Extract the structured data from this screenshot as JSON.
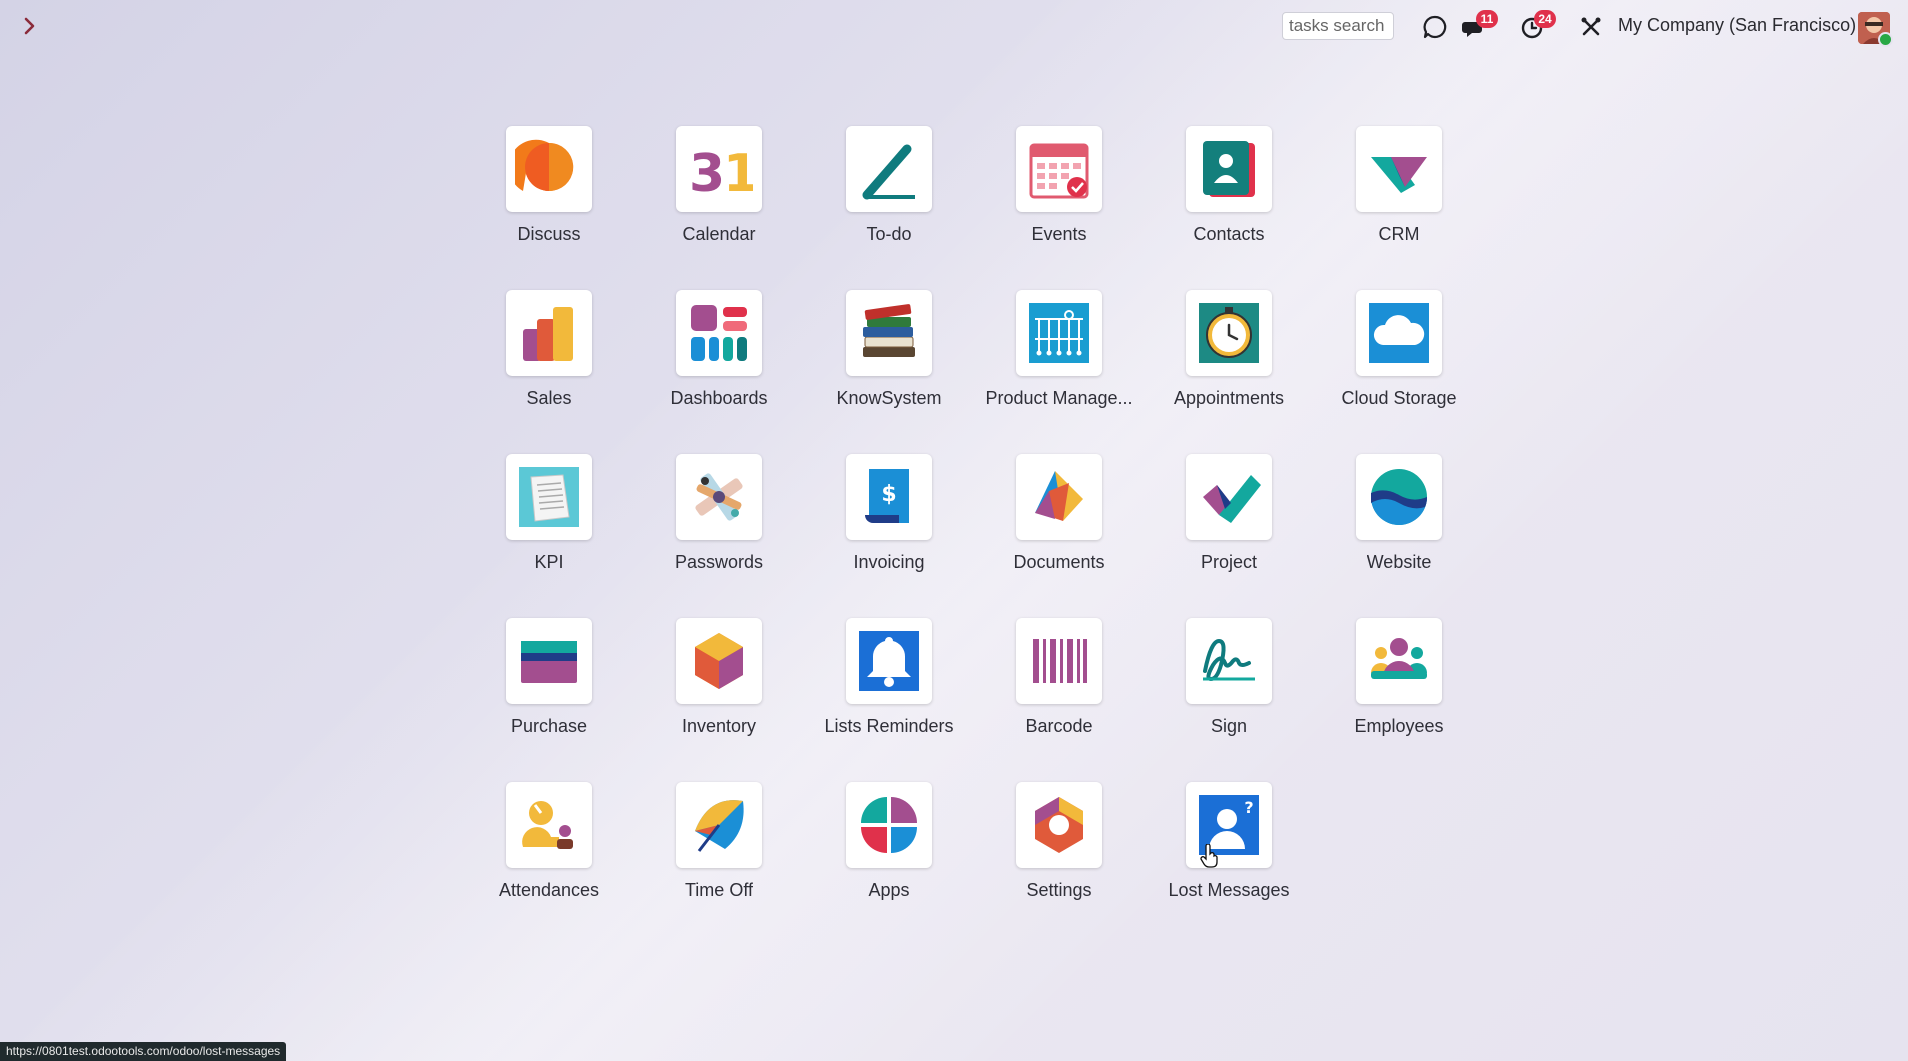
{
  "topbar": {
    "search_placeholder": "tasks search",
    "messages_count": "11",
    "activities_count": "24",
    "company": "My Company (San Francisco)"
  },
  "apps": [
    {
      "label": "Discuss",
      "icon": "discuss-icon"
    },
    {
      "label": "Calendar",
      "icon": "calendar-icon"
    },
    {
      "label": "To-do",
      "icon": "todo-icon"
    },
    {
      "label": "Events",
      "icon": "events-icon"
    },
    {
      "label": "Contacts",
      "icon": "contacts-icon"
    },
    {
      "label": "CRM",
      "icon": "crm-icon"
    },
    {
      "label": "Sales",
      "icon": "sales-icon"
    },
    {
      "label": "Dashboards",
      "icon": "dashboards-icon"
    },
    {
      "label": "KnowSystem",
      "icon": "knowsystem-icon"
    },
    {
      "label": "Product Manage...",
      "icon": "product-management-icon"
    },
    {
      "label": "Appointments",
      "icon": "appointments-icon"
    },
    {
      "label": "Cloud Storage",
      "icon": "cloud-storage-icon"
    },
    {
      "label": "KPI",
      "icon": "kpi-icon"
    },
    {
      "label": "Passwords",
      "icon": "passwords-icon"
    },
    {
      "label": "Invoicing",
      "icon": "invoicing-icon"
    },
    {
      "label": "Documents",
      "icon": "documents-icon"
    },
    {
      "label": "Project",
      "icon": "project-icon"
    },
    {
      "label": "Website",
      "icon": "website-icon"
    },
    {
      "label": "Purchase",
      "icon": "purchase-icon"
    },
    {
      "label": "Inventory",
      "icon": "inventory-icon"
    },
    {
      "label": "Lists Reminders",
      "icon": "lists-reminders-icon"
    },
    {
      "label": "Barcode",
      "icon": "barcode-icon"
    },
    {
      "label": "Sign",
      "icon": "sign-icon"
    },
    {
      "label": "Employees",
      "icon": "employees-icon"
    },
    {
      "label": "Attendances",
      "icon": "attendances-icon"
    },
    {
      "label": "Time Off",
      "icon": "time-off-icon"
    },
    {
      "label": "Apps",
      "icon": "apps-icon"
    },
    {
      "label": "Settings",
      "icon": "settings-icon"
    },
    {
      "label": "Lost Messages",
      "icon": "lost-messages-icon"
    }
  ],
  "status_url": "https://0801test.odootools.com/odoo/lost-messages",
  "colors": {
    "badge": "#e0314b",
    "toggle_arrow": "#8a2b3a"
  }
}
